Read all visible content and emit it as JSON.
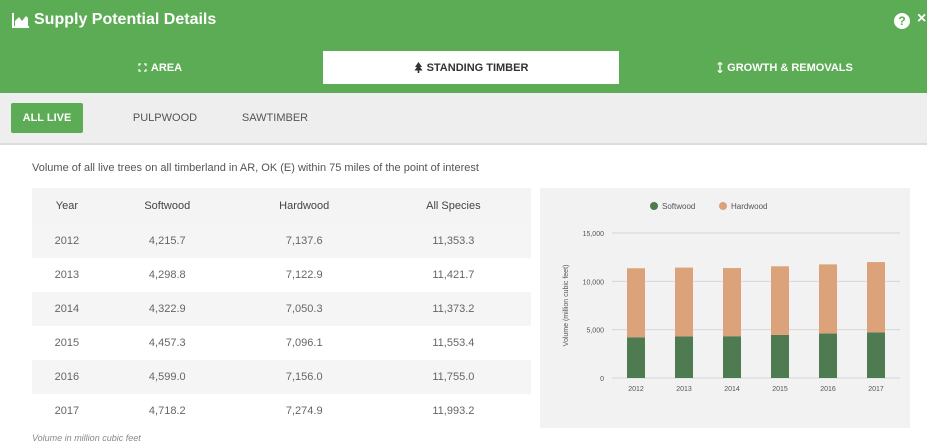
{
  "header": {
    "title": "Supply Potential Details",
    "help_label": "?",
    "close_label": "×"
  },
  "tabs": [
    {
      "label": "AREA",
      "icon": "area-icon",
      "active": false
    },
    {
      "label": "STANDING TIMBER",
      "icon": "tree-icon",
      "active": true
    },
    {
      "label": "GROWTH & REMOVALS",
      "icon": "growth-icon",
      "active": false
    }
  ],
  "subtabs": [
    {
      "label": "ALL LIVE",
      "active": true
    },
    {
      "label": "PULPWOOD",
      "active": false
    },
    {
      "label": "SAWTIMBER",
      "active": false
    }
  ],
  "description": "Volume of all live trees on all timberland in AR, OK (E) within 75 miles of the point of interest",
  "table": {
    "headers": [
      "Year",
      "Softwood",
      "Hardwood",
      "All Species"
    ],
    "rows": [
      [
        "2012",
        "4,215.7",
        "7,137.6",
        "11,353.3"
      ],
      [
        "2013",
        "4,298.8",
        "7,122.9",
        "11,421.7"
      ],
      [
        "2014",
        "4,322.9",
        "7,050.3",
        "11,373.2"
      ],
      [
        "2015",
        "4,457.3",
        "7,096.1",
        "11,553.4"
      ],
      [
        "2016",
        "4,599.0",
        "7,156.0",
        "11,755.0"
      ],
      [
        "2017",
        "4,718.2",
        "7,274.9",
        "11,993.2"
      ]
    ]
  },
  "footnote": "Volume in million cubic feet",
  "colors": {
    "brand_green": "#5cab55",
    "softwood": "#4e7b52",
    "hardwood": "#dca27a"
  },
  "chart_data": {
    "type": "bar",
    "stacked": true,
    "categories": [
      "2012",
      "2013",
      "2014",
      "2015",
      "2016",
      "2017"
    ],
    "series": [
      {
        "name": "Softwood",
        "values": [
          4215.7,
          4298.8,
          4322.9,
          4457.3,
          4599.0,
          4718.2
        ],
        "color": "#4e7b52"
      },
      {
        "name": "Hardwood",
        "values": [
          7137.6,
          7122.9,
          7050.3,
          7096.1,
          7156.0,
          7274.9
        ],
        "color": "#dca27a"
      }
    ],
    "ylabel": "Volume (million cubic feet)",
    "ylim": [
      0,
      15000
    ],
    "yticks": [
      0,
      5000,
      10000,
      15000
    ],
    "ytick_labels": [
      "0",
      "5,000",
      "10,000",
      "15,000"
    ],
    "legend_position": "top",
    "grid": true
  }
}
